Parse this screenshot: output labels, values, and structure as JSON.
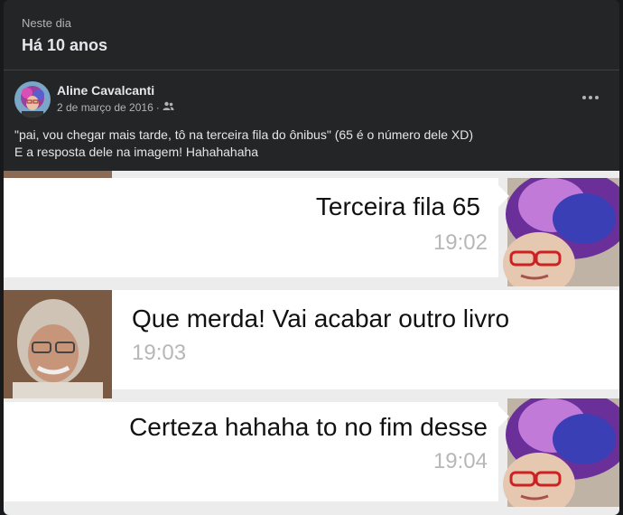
{
  "memory": {
    "subtitle": "Neste dia",
    "title": "Há 10 anos"
  },
  "post": {
    "author": "Aline Cavalcanti",
    "date": "2 de março de 2016",
    "separator": "·",
    "audience_icon": "friends-icon",
    "text_line1": "\"pai, vou chegar mais tarde, tô na terceira fila do ônibus\" (65 é o número dele XD)",
    "text_line2": "E a resposta dele na imagem! Hahahahaha"
  },
  "chat": {
    "messages": [
      {
        "text": "Terceira fila 65",
        "time": "19:02",
        "sender": "right"
      },
      {
        "text": "Que merda! Vai acabar outro livro",
        "time": "19:03",
        "sender": "left"
      },
      {
        "text": "Certeza hahaha to no fim desse",
        "time": "19:04",
        "sender": "right"
      }
    ]
  },
  "colors": {
    "card": "#242526",
    "text": "#e4e6eb",
    "muted": "#b0b3b8",
    "chat_bg": "#ececec"
  }
}
